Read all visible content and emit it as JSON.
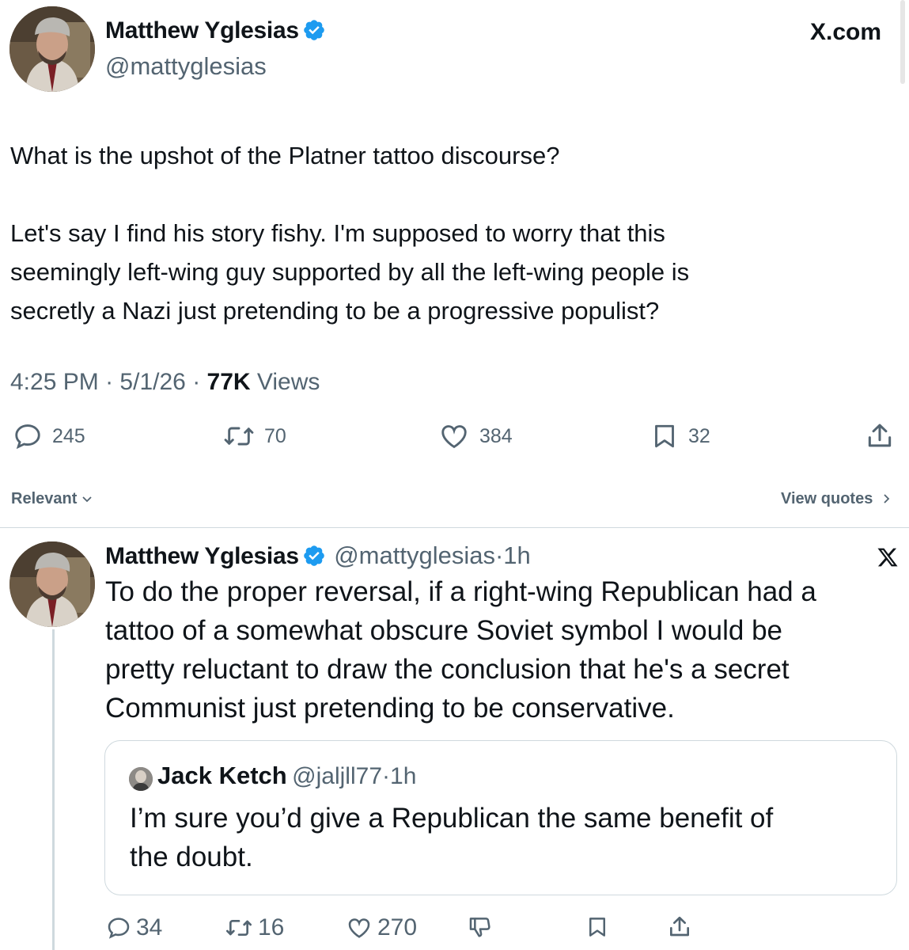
{
  "header": {
    "site_label": "X.com",
    "author_name": "Matthew Yglesias",
    "author_handle": "@mattyglesias"
  },
  "main_tweet": {
    "paragraph1": "What is the upshot of the Platner tattoo discourse?",
    "paragraph2_lines": [
      "Let's say I find his story fishy. I'm supposed to worry that this",
      "seemingly left-wing guy supported by all the left-wing people is",
      "secretly a Nazi just pretending to be a progressive populist?"
    ],
    "time": "4:25 PM",
    "date": "5/1/26",
    "views_count": "77K",
    "views_label": "Views",
    "separator": "·",
    "actions": {
      "replies": "245",
      "reposts": "70",
      "likes": "384",
      "bookmarks": "32"
    }
  },
  "sort": {
    "label": "Relevant",
    "view_quotes": "View quotes"
  },
  "reply": {
    "author_name": "Matthew Yglesias",
    "author_handle": "@mattyglesias",
    "time": "1h",
    "separator": "·",
    "text_lines": [
      "To do the proper reversal, if a right-wing Republican had a",
      "tattoo of a somewhat obscure Soviet symbol I would be",
      "pretty reluctant to draw the conclusion that he's a secret",
      "Communist just pretending to be conservative."
    ],
    "quote": {
      "author_name": "Jack Ketch",
      "author_handle": "@jaljll77",
      "time": "1h",
      "separator": "·",
      "text_lines": [
        "I’m sure you’d give a Republican the same benefit of",
        "the doubt."
      ]
    },
    "actions": {
      "replies": "34",
      "reposts": "16",
      "likes": "270"
    }
  },
  "colors": {
    "text": "#0f1419",
    "muted": "#536471",
    "verified": "#1d9bf0",
    "border": "#cfd9de"
  },
  "icons": [
    "verified-badge-icon",
    "x-logo-icon",
    "reply-icon",
    "repost-icon",
    "like-icon",
    "bookmark-icon",
    "share-icon",
    "chevron-down-icon",
    "chevron-right-icon",
    "dislike-icon"
  ]
}
